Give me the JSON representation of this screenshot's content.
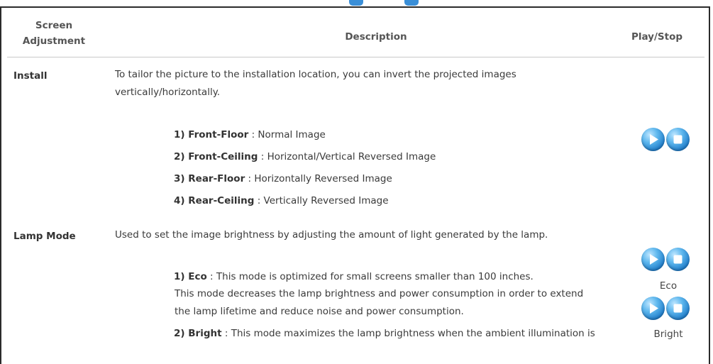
{
  "header": {
    "screen_adjustment": "Screen Adjustment",
    "description": "Description",
    "play_stop": "Play/Stop"
  },
  "install": {
    "label": "Install",
    "text": "To tailor the picture to the installation location, you can invert the projected images vertically/horizontally.",
    "items": [
      {
        "name": "1) Front-Floor",
        "desc": " : Normal Image"
      },
      {
        "name": "2) Front-Ceiling",
        "desc": " : Horizontal/Vertical Reversed Image"
      },
      {
        "name": "3) Rear-Floor",
        "desc": " : Horizontally Reversed Image"
      },
      {
        "name": "4) Rear-Ceiling",
        "desc": " : Vertically Reversed Image"
      }
    ]
  },
  "lamp": {
    "label": "Lamp Mode",
    "text": "Used to set the image brightness by adjusting the amount of light generated by the lamp.",
    "items": [
      {
        "name": "1) Eco",
        "desc": " : This mode is optimized for small screens smaller than 100 inches."
      },
      {
        "name": "2) Bright",
        "desc": " : This mode maximizes the lamp brightness when the ambient illumination is"
      }
    ],
    "eco_cont_1": "This mode decreases the lamp brightness and power consumption in order to extend",
    "eco_cont_2": "the lamp lifetime and reduce noise and power consumption.",
    "btn_label_eco": "Eco",
    "btn_label_bright": "Bright"
  },
  "icons": {
    "play": "play-icon",
    "stop": "stop-icon"
  },
  "colors": {
    "button_blue": "#1f7cc9",
    "frame": "#2b2b2b"
  }
}
